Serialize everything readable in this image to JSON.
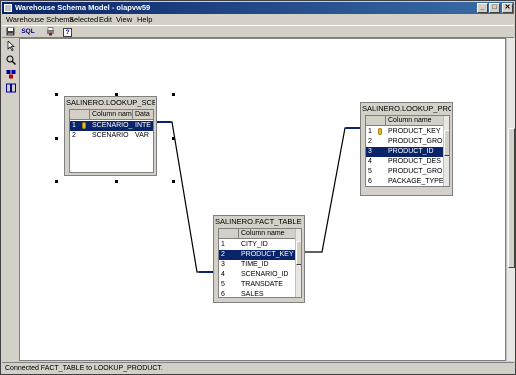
{
  "window": {
    "title": "Warehouse Schema Model - olapvw59",
    "min_label": "_",
    "max_label": "□",
    "close_label": "✕"
  },
  "menu": [
    "Warehouse Schema",
    "Selected",
    "Edit",
    "View",
    "Help"
  ],
  "toolbar": {
    "save_icon": "save-icon",
    "sql_label": "SQL",
    "print_icon": "print-icon",
    "help_label": "?"
  },
  "tools": [
    "pointer-icon",
    "zoom-icon",
    "table-icon",
    "join-icon"
  ],
  "tables": {
    "scenario": {
      "title": "SALINERO.LOOKUP_SCENARIO",
      "headers": [
        "",
        "Column name",
        "Data"
      ],
      "rows": [
        {
          "n": "1",
          "name": "SCENARIO_...",
          "type": "INTE",
          "key": true,
          "selected": true
        },
        {
          "n": "2",
          "name": "SCENARIO",
          "type": "VAR",
          "key": false,
          "selected": false
        }
      ]
    },
    "product": {
      "title": "SALINERO.LOOKUP_PRODUCT",
      "headers": [
        "",
        "Column name"
      ],
      "rows": [
        {
          "n": "1",
          "name": "PRODUCT_KEY",
          "key": true,
          "selected": false
        },
        {
          "n": "2",
          "name": "PRODUCT_GRO",
          "key": false,
          "selected": false
        },
        {
          "n": "3",
          "name": "PRODUCT_ID",
          "key": false,
          "selected": true
        },
        {
          "n": "4",
          "name": "PRODUCT_DES",
          "key": false,
          "selected": false
        },
        {
          "n": "5",
          "name": "PRODUCT_GRO",
          "key": false,
          "selected": false
        },
        {
          "n": "6",
          "name": "PACKAGE_TYPE",
          "key": false,
          "selected": false
        }
      ]
    },
    "fact": {
      "title": "SALINERO.FACT_TABLE",
      "headers": [
        "",
        "Column name"
      ],
      "rows": [
        {
          "n": "1",
          "name": "CITY_ID",
          "key": false,
          "selected": false
        },
        {
          "n": "2",
          "name": "PRODUCT_KEY",
          "key": false,
          "selected": true
        },
        {
          "n": "3",
          "name": "TIME_ID",
          "key": false,
          "selected": false
        },
        {
          "n": "4",
          "name": "SCENARIO_ID",
          "key": false,
          "selected": false
        },
        {
          "n": "5",
          "name": "TRANSDATE",
          "key": false,
          "selected": false
        },
        {
          "n": "6",
          "name": "SALES",
          "key": false,
          "selected": false
        }
      ]
    }
  },
  "status": "Connected FACT_TABLE to LOOKUP_PRODUCT."
}
